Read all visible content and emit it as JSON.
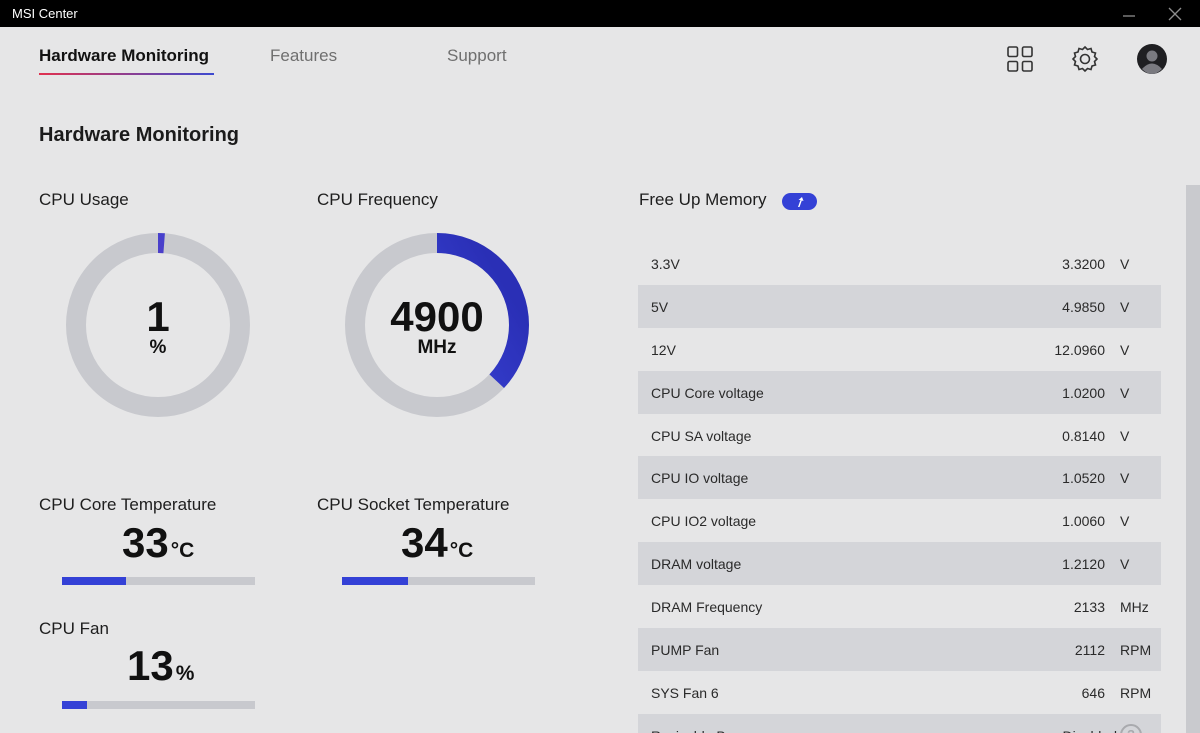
{
  "window": {
    "title": "MSI Center",
    "minimize_icon": "minimize-icon",
    "close_icon": "close-icon"
  },
  "nav": {
    "tabs": [
      {
        "label": "Hardware Monitoring",
        "active": true
      },
      {
        "label": "Features",
        "active": false
      },
      {
        "label": "Support",
        "active": false
      }
    ],
    "icons": [
      "grid-icon",
      "gear-icon",
      "user-avatar-icon"
    ]
  },
  "page_title": "Hardware Monitoring",
  "cpu_usage": {
    "label": "CPU Usage",
    "value": "1",
    "unit": "%",
    "percent": 1
  },
  "cpu_frequency": {
    "label": "CPU Frequency",
    "value": "4900",
    "unit": "MHz",
    "gauge_fraction": 0.37
  },
  "cpu_core_temp": {
    "label": "CPU Core Temperature",
    "value": "33",
    "unit": "°C",
    "bar_fraction": 0.33
  },
  "cpu_socket_temp": {
    "label": "CPU Socket Temperature",
    "value": "34",
    "unit": "°C",
    "bar_fraction": 0.34
  },
  "cpu_fan": {
    "label": "CPU Fan",
    "value": "13",
    "unit": "%",
    "bar_fraction": 0.13
  },
  "free_memory": {
    "label": "Free Up Memory",
    "button_icon": "boost-arrow-icon"
  },
  "readings": [
    {
      "name": "3.3V",
      "value": "3.3200",
      "unit": "V"
    },
    {
      "name": "5V",
      "value": "4.9850",
      "unit": "V"
    },
    {
      "name": "12V",
      "value": "12.0960",
      "unit": "V"
    },
    {
      "name": "CPU Core voltage",
      "value": "1.0200",
      "unit": "V"
    },
    {
      "name": "CPU SA voltage",
      "value": "0.8140",
      "unit": "V"
    },
    {
      "name": "CPU IO voltage",
      "value": "1.0520",
      "unit": "V"
    },
    {
      "name": "CPU IO2 voltage",
      "value": "1.0060",
      "unit": "V"
    },
    {
      "name": "DRAM voltage",
      "value": "1.2120",
      "unit": "V"
    },
    {
      "name": "DRAM Frequency",
      "value": "2133",
      "unit": "MHz"
    },
    {
      "name": "PUMP Fan",
      "value": "2112",
      "unit": "RPM"
    },
    {
      "name": "SYS Fan 6",
      "value": "646",
      "unit": "RPM"
    },
    {
      "name": "Resizable Bar",
      "value": "Disabled",
      "unit": ""
    }
  ],
  "colors": {
    "accent": "#3441d6",
    "accent_purple": "#8a3aa8",
    "track": "#c8c9ce",
    "background": "#e6e6e7"
  }
}
